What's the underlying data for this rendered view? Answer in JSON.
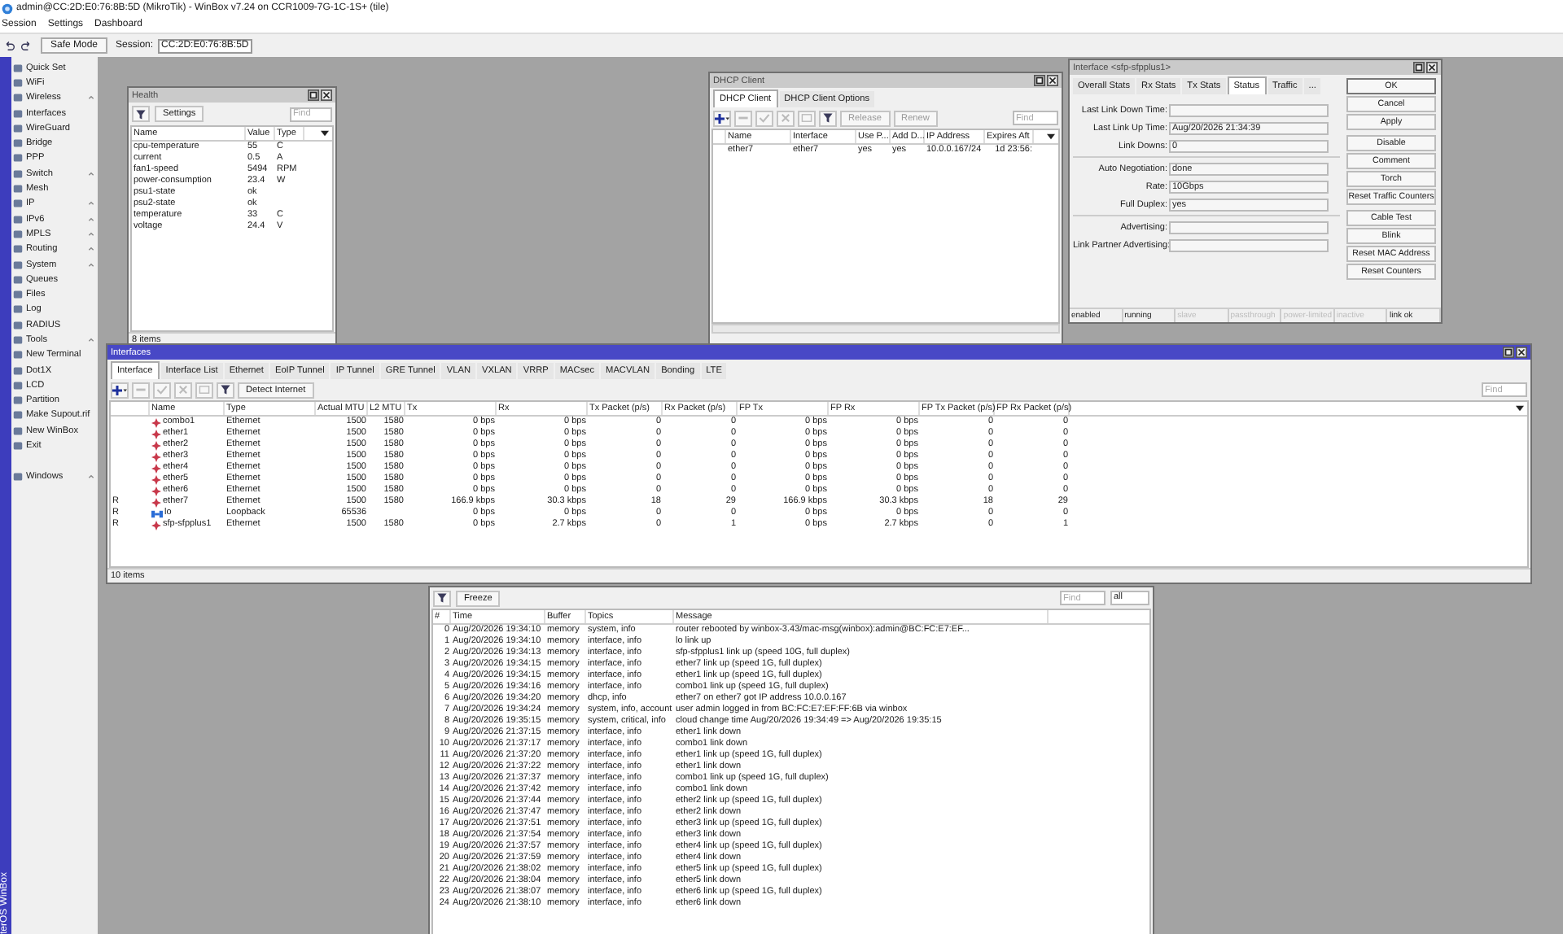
{
  "window": {
    "title": "admin@CC:2D:E0:76:8B:5D (MikroTik) - WinBox v7.24 on CCR1009-7G-1C-1S+ (tile)"
  },
  "menu": [
    "Session",
    "Settings",
    "Dashboard"
  ],
  "toolbar": {
    "safe_mode": "Safe Mode",
    "session_label": "Session:",
    "session_value": "CC:2D:E0:76:8B:5D"
  },
  "sidebar": {
    "brand": "terOS WinBox",
    "items": [
      {
        "label": "Quick Set",
        "submenu": false
      },
      {
        "label": "WiFi",
        "submenu": false
      },
      {
        "label": "Wireless",
        "submenu": true
      },
      {
        "label": "Interfaces",
        "submenu": false
      },
      {
        "label": "WireGuard",
        "submenu": false
      },
      {
        "label": "Bridge",
        "submenu": false
      },
      {
        "label": "PPP",
        "submenu": false
      },
      {
        "label": "Switch",
        "submenu": true
      },
      {
        "label": "Mesh",
        "submenu": false
      },
      {
        "label": "IP",
        "submenu": true
      },
      {
        "label": "IPv6",
        "submenu": true
      },
      {
        "label": "MPLS",
        "submenu": true
      },
      {
        "label": "Routing",
        "submenu": true
      },
      {
        "label": "System",
        "submenu": true
      },
      {
        "label": "Queues",
        "submenu": false
      },
      {
        "label": "Files",
        "submenu": false
      },
      {
        "label": "Log",
        "submenu": false
      },
      {
        "label": "RADIUS",
        "submenu": false
      },
      {
        "label": "Tools",
        "submenu": true
      },
      {
        "label": "New Terminal",
        "submenu": false
      },
      {
        "label": "Dot1X",
        "submenu": false
      },
      {
        "label": "LCD",
        "submenu": false
      },
      {
        "label": "Partition",
        "submenu": false
      },
      {
        "label": "Make Supout.rif",
        "submenu": false
      },
      {
        "label": "New WinBox",
        "submenu": false
      },
      {
        "label": "Exit",
        "submenu": false
      }
    ],
    "bottom_items": [
      {
        "label": "Windows",
        "submenu": true
      }
    ]
  },
  "health": {
    "title": "Health",
    "active": false,
    "settings": "Settings",
    "find_placeholder": "Find",
    "columns": [
      "Name",
      "Value",
      "Type"
    ],
    "rows": [
      [
        "cpu-temperature",
        "55",
        "C"
      ],
      [
        "current",
        "0.5",
        "A"
      ],
      [
        "fan1-speed",
        "5494",
        "RPM"
      ],
      [
        "power-consumption",
        "23.4",
        "W"
      ],
      [
        "psu1-state",
        "ok"
      ],
      [
        "psu2-state",
        "ok"
      ],
      [
        "temperature",
        "33",
        "C"
      ],
      [
        "voltage",
        "24.4",
        "V"
      ]
    ],
    "status": "8 items"
  },
  "dhcp_client": {
    "title": "DHCP Client",
    "active": false,
    "tabs": [
      {
        "label": "DHCP Client",
        "selected": true
      },
      {
        "label": "DHCP Client Options",
        "selected": false
      }
    ],
    "buttons": [
      "Release",
      "Renew"
    ],
    "find_placeholder": "Find",
    "columns": [
      "Name",
      "Interface",
      "Use P...",
      "Add D...",
      "IP Address",
      "Expires Aft"
    ],
    "rows": [
      [
        "ether7",
        "ether7",
        "yes",
        "yes",
        "10.0.0.167/24",
        "1d 23:56:"
      ]
    ]
  },
  "interface_window": {
    "title": "Interface <sfp-sfpplus1>",
    "active": false,
    "tabs": [
      {
        "label": "Overall Stats",
        "selected": false
      },
      {
        "label": "Rx Stats",
        "selected": false
      },
      {
        "label": "Tx Stats",
        "selected": false
      },
      {
        "label": "Status",
        "selected": true
      },
      {
        "label": "Traffic",
        "selected": false
      },
      {
        "label": "...",
        "selected": false
      }
    ],
    "field_groups": [
      [
        {
          "label": "Last Link Down Time:"
        },
        {
          "label": "Last Link Up Time:",
          "value": "Aug/20/2026 21:34:39"
        },
        {
          "label": "Link Downs:",
          "value": "0"
        }
      ],
      [
        {
          "label": "Auto Negotiation:",
          "value": "done"
        },
        {
          "label": "Rate:",
          "value": "10Gbps"
        },
        {
          "label": "Full Duplex:",
          "value": "yes"
        }
      ],
      [
        {
          "label": "Advertising:"
        },
        {
          "label": "Link Partner Advertising:"
        }
      ]
    ],
    "button_groups": [
      [
        "OK",
        "Cancel",
        "Apply"
      ],
      [
        "Disable",
        "Comment",
        "Torch",
        "Reset Traffic Counters"
      ],
      [
        "Cable Test",
        "Blink",
        "Reset MAC Address",
        "Reset Counters"
      ]
    ],
    "status_flags": [
      {
        "label": "enabled",
        "active": true
      },
      {
        "label": "running",
        "active": true
      },
      {
        "label": "slave",
        "active": false
      },
      {
        "label": "passthrough",
        "active": false
      },
      {
        "label": "power-limited",
        "active": false
      },
      {
        "label": "inactive",
        "active": false
      },
      {
        "label": "link ok",
        "active": true
      }
    ]
  },
  "interfaces": {
    "title": "Interfaces",
    "active": true,
    "tabs": [
      {
        "label": "Interface",
        "selected": true
      },
      {
        "label": "Interface List",
        "selected": false
      },
      {
        "label": "Ethernet",
        "selected": false
      },
      {
        "label": "EoIP Tunnel",
        "selected": false
      },
      {
        "label": "IP Tunnel",
        "selected": false
      },
      {
        "label": "GRE Tunnel",
        "selected": false
      },
      {
        "label": "VLAN",
        "selected": false
      },
      {
        "label": "VXLAN",
        "selected": false
      },
      {
        "label": "VRRP",
        "selected": false
      },
      {
        "label": "MACsec",
        "selected": false
      },
      {
        "label": "MACVLAN",
        "selected": false
      },
      {
        "label": "Bonding",
        "selected": false
      },
      {
        "label": "LTE",
        "selected": false
      }
    ],
    "detect_button": "Detect Internet",
    "find_placeholder": "Find",
    "columns": [
      "Name",
      "Type",
      "Actual MTU",
      "L2 MTU",
      "Tx",
      "Rx",
      "Tx Packet (p/s)",
      "Rx Packet (p/s)",
      "FP Tx",
      "FP Rx",
      "FP Tx Packet (p/s)",
      "FP Rx Packet (p/s)"
    ],
    "rows": [
      {
        "kind": "ethernet",
        "cells": [
          "combo1",
          "Ethernet",
          "1500",
          "1580",
          "0 bps",
          "0 bps",
          "0",
          "0",
          "0 bps",
          "0 bps",
          "0",
          "0"
        ]
      },
      {
        "kind": "ethernet",
        "cells": [
          "ether1",
          "Ethernet",
          "1500",
          "1580",
          "0 bps",
          "0 bps",
          "0",
          "0",
          "0 bps",
          "0 bps",
          "0",
          "0"
        ]
      },
      {
        "kind": "ethernet",
        "cells": [
          "ether2",
          "Ethernet",
          "1500",
          "1580",
          "0 bps",
          "0 bps",
          "0",
          "0",
          "0 bps",
          "0 bps",
          "0",
          "0"
        ]
      },
      {
        "kind": "ethernet",
        "cells": [
          "ether3",
          "Ethernet",
          "1500",
          "1580",
          "0 bps",
          "0 bps",
          "0",
          "0",
          "0 bps",
          "0 bps",
          "0",
          "0"
        ]
      },
      {
        "kind": "ethernet",
        "cells": [
          "ether4",
          "Ethernet",
          "1500",
          "1580",
          "0 bps",
          "0 bps",
          "0",
          "0",
          "0 bps",
          "0 bps",
          "0",
          "0"
        ]
      },
      {
        "kind": "ethernet",
        "cells": [
          "ether5",
          "Ethernet",
          "1500",
          "1580",
          "0 bps",
          "0 bps",
          "0",
          "0",
          "0 bps",
          "0 bps",
          "0",
          "0"
        ]
      },
      {
        "kind": "ethernet",
        "cells": [
          "ether6",
          "Ethernet",
          "1500",
          "1580",
          "0 bps",
          "0 bps",
          "0",
          "0",
          "0 bps",
          "0 bps",
          "0",
          "0"
        ]
      },
      {
        "flag": "R",
        "kind": "ethernet",
        "cells": [
          "ether7",
          "Ethernet",
          "1500",
          "1580",
          "166.9 kbps",
          "30.3 kbps",
          "18",
          "29",
          "166.9 kbps",
          "30.3 kbps",
          "18",
          "29"
        ]
      },
      {
        "flag": "R",
        "kind": "loopback",
        "cells": [
          "lo",
          "Loopback",
          "65536",
          null,
          "0 bps",
          "0 bps",
          "0",
          "0",
          "0 bps",
          "0 bps",
          "0",
          "0"
        ]
      },
      {
        "flag": "R",
        "kind": "ethernet",
        "cells": [
          "sfp-sfpplus1",
          "Ethernet",
          "1500",
          "1580",
          "0 bps",
          "2.7 kbps",
          "0",
          "1",
          "0 bps",
          "2.7 kbps",
          "0",
          "1"
        ]
      }
    ],
    "status": "10 items"
  },
  "log": {
    "freeze": "Freeze",
    "find_placeholder": "Find",
    "filter_value": "all",
    "columns": [
      "#",
      "Time",
      "Buffer",
      "Topics",
      "Message"
    ],
    "rows": [
      [
        "0",
        "Aug/20/2026 19:34:10",
        "memory",
        "system, info",
        "router rebooted by winbox-3.43/mac-msg(winbox):admin@BC:FC:E7:EF..."
      ],
      [
        "1",
        "Aug/20/2026 19:34:10",
        "memory",
        "interface, info",
        "lo link up"
      ],
      [
        "2",
        "Aug/20/2026 19:34:13",
        "memory",
        "interface, info",
        "sfp-sfpplus1 link up (speed 10G, full duplex)"
      ],
      [
        "3",
        "Aug/20/2026 19:34:15",
        "memory",
        "interface, info",
        "ether7 link up (speed 1G, full duplex)"
      ],
      [
        "4",
        "Aug/20/2026 19:34:15",
        "memory",
        "interface, info",
        "ether1 link up (speed 1G, full duplex)"
      ],
      [
        "5",
        "Aug/20/2026 19:34:16",
        "memory",
        "interface, info",
        "combo1 link up (speed 1G, full duplex)"
      ],
      [
        "6",
        "Aug/20/2026 19:34:20",
        "memory",
        "dhcp, info",
        "ether7 on ether7 got IP address 10.0.0.167"
      ],
      [
        "7",
        "Aug/20/2026 19:34:24",
        "memory",
        "system, info, account",
        "user admin logged in from BC:FC:E7:EF:FF:6B via winbox"
      ],
      [
        "8",
        "Aug/20/2026 19:35:15",
        "memory",
        "system, critical, info",
        "cloud change time Aug/20/2026 19:34:49 => Aug/20/2026 19:35:15"
      ],
      [
        "9",
        "Aug/20/2026 21:37:15",
        "memory",
        "interface, info",
        "ether1 link down"
      ],
      [
        "10",
        "Aug/20/2026 21:37:17",
        "memory",
        "interface, info",
        "combo1 link down"
      ],
      [
        "11",
        "Aug/20/2026 21:37:20",
        "memory",
        "interface, info",
        "ether1 link up (speed 1G, full duplex)"
      ],
      [
        "12",
        "Aug/20/2026 21:37:22",
        "memory",
        "interface, info",
        "ether1 link down"
      ],
      [
        "13",
        "Aug/20/2026 21:37:37",
        "memory",
        "interface, info",
        "combo1 link up (speed 1G, full duplex)"
      ],
      [
        "14",
        "Aug/20/2026 21:37:42",
        "memory",
        "interface, info",
        "combo1 link down"
      ],
      [
        "15",
        "Aug/20/2026 21:37:44",
        "memory",
        "interface, info",
        "ether2 link up (speed 1G, full duplex)"
      ],
      [
        "16",
        "Aug/20/2026 21:37:47",
        "memory",
        "interface, info",
        "ether2 link down"
      ],
      [
        "17",
        "Aug/20/2026 21:37:51",
        "memory",
        "interface, info",
        "ether3 link up (speed 1G, full duplex)"
      ],
      [
        "18",
        "Aug/20/2026 21:37:54",
        "memory",
        "interface, info",
        "ether3 link down"
      ],
      [
        "19",
        "Aug/20/2026 21:37:57",
        "memory",
        "interface, info",
        "ether4 link up (speed 1G, full duplex)"
      ],
      [
        "20",
        "Aug/20/2026 21:37:59",
        "memory",
        "interface, info",
        "ether4 link down"
      ],
      [
        "21",
        "Aug/20/2026 21:38:02",
        "memory",
        "interface, info",
        "ether5 link up (speed 1G, full duplex)"
      ],
      [
        "22",
        "Aug/20/2026 21:38:04",
        "memory",
        "interface, info",
        "ether5 link down"
      ],
      [
        "23",
        "Aug/20/2026 21:38:07",
        "memory",
        "interface, info",
        "ether6 link up (speed 1G, full duplex)"
      ],
      [
        "24",
        "Aug/20/2026 21:38:10",
        "memory",
        "interface, info",
        "ether6 link down"
      ]
    ]
  }
}
